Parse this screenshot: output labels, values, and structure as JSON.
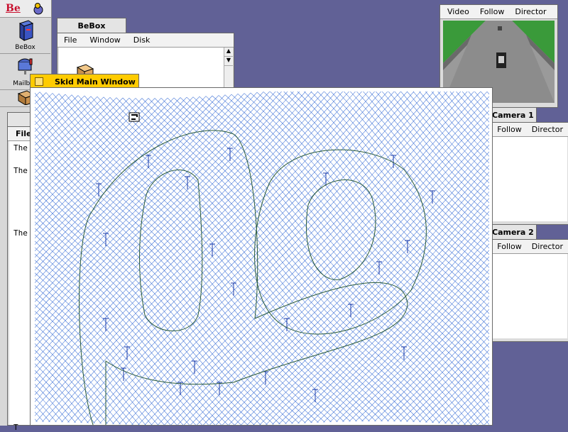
{
  "deskbar": {
    "be_label": "Be",
    "items": [
      {
        "label": "BeBox",
        "icon": "bebox-icon"
      },
      {
        "label": "Mailbox",
        "icon": "mailbox-icon"
      },
      {
        "label": "",
        "icon": "folder-icon"
      }
    ]
  },
  "bebox_window": {
    "title": "BeBox",
    "menus": [
      "File",
      "Window",
      "Disk"
    ]
  },
  "file_window": {
    "menu_label": "File",
    "lines": [
      "The",
      "The",
      "The",
      "T"
    ]
  },
  "camera_main": {
    "menus": [
      "Video",
      "Follow",
      "Director"
    ]
  },
  "camera1": {
    "title": "Camera 1",
    "menus": [
      "Follow",
      "Director"
    ]
  },
  "camera2": {
    "title": "Camera 2",
    "menus": [
      "Follow",
      "Director"
    ]
  },
  "skid_window": {
    "title": "Skid Main Window"
  }
}
